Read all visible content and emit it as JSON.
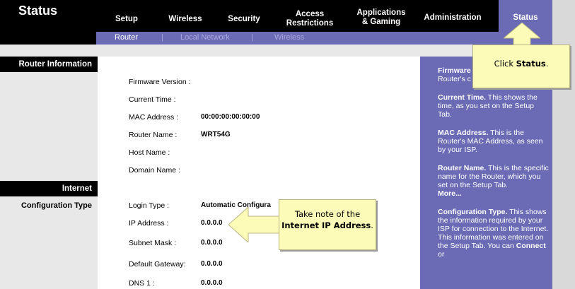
{
  "header": {
    "page_title": "Status",
    "tabs": [
      {
        "label": "Setup"
      },
      {
        "label": "Wireless"
      },
      {
        "label": "Security"
      },
      {
        "label": "Access Restrictions"
      },
      {
        "label": "Applications & Gaming"
      },
      {
        "label": "Administration"
      },
      {
        "label": "Status"
      }
    ],
    "subtabs": [
      {
        "label": "Router"
      },
      {
        "label": "|"
      },
      {
        "label": "Local Network"
      },
      {
        "label": "|"
      },
      {
        "label": "Wireless"
      }
    ]
  },
  "sidebar": {
    "router_info": "Router Information",
    "internet": "Internet",
    "config_type": "Configuration Type"
  },
  "fields": {
    "firmware_label": "Firmware Version :",
    "time_label": "Current Time :",
    "mac_label": "MAC Address :",
    "mac_value": "00:00:00:00:00:00",
    "router_name_label": "Router Name :",
    "router_name_value": "WRT54G",
    "host_label": "Host Name :",
    "domain_label": "Domain Name :",
    "login_label": "Login Type :",
    "login_value": "Automatic Configura",
    "ip_label": "IP Address :",
    "ip_value": "0.0.0.0",
    "subnet_label": "Subnet Mask :",
    "subnet_value": "0.0.0.0",
    "gateway_label": "Default Gateway:",
    "gateway_value": "0.0.0.0",
    "dns_label": "DNS 1 :",
    "dns_value": "0.0.0.0"
  },
  "help": {
    "firmware_title": "Firmware",
    "firmware_text": "Router's c",
    "time_title": "Current Time.",
    "time_text": " This shows the time, as you set on the Setup Tab.",
    "mac_title": "MAC Address.",
    "mac_text": " This is the Router's MAC Address, as seen by your ISP.",
    "name_title": "Router Name.",
    "name_text": " This is the specific name for the Router, which you set on the Setup Tab.",
    "more": "More...",
    "config_title": "Configuration Type.",
    "config_text": " This shows the information required by your ISP for connection to the Internet. This information was entered on the Setup Tab. You can ",
    "connect": "Connect",
    "or_text": " or"
  },
  "callouts": {
    "status_pre": "Click ",
    "status_bold": "Status",
    "status_post": ".",
    "ip_pre": "Take note of the",
    "ip_bold": "Internet IP Address",
    "ip_post": "."
  }
}
